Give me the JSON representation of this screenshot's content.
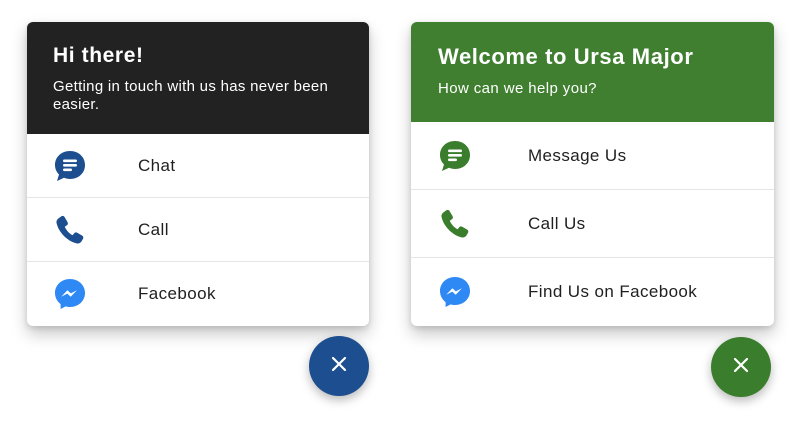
{
  "colors": {
    "widget1_accent": "#1d4e8f",
    "widget1_header_bg": "#222222",
    "widget2_accent": "#3a7d2c",
    "widget2_header_bg": "#3f7f2f",
    "messenger_blue": "#2f89f5",
    "text_dark": "#1f1f1f"
  },
  "widget1": {
    "header": {
      "title": "Hi there!",
      "subtitle": "Getting in touch with us has never been easier."
    },
    "options": [
      {
        "label": "Chat",
        "icon": "chat-bubble-icon"
      },
      {
        "label": "Call",
        "icon": "phone-icon"
      },
      {
        "label": "Facebook",
        "icon": "messenger-icon"
      }
    ],
    "close_button": {
      "glyph": "×",
      "icon": "close-icon"
    }
  },
  "widget2": {
    "header": {
      "title": "Welcome to Ursa Major",
      "subtitle": "How can we help you?"
    },
    "options": [
      {
        "label": "Message Us",
        "icon": "chat-bubble-icon"
      },
      {
        "label": "Call Us",
        "icon": "phone-icon"
      },
      {
        "label": "Find Us on Facebook",
        "icon": "messenger-icon"
      }
    ],
    "close_button": {
      "glyph": "×",
      "icon": "close-icon"
    }
  }
}
